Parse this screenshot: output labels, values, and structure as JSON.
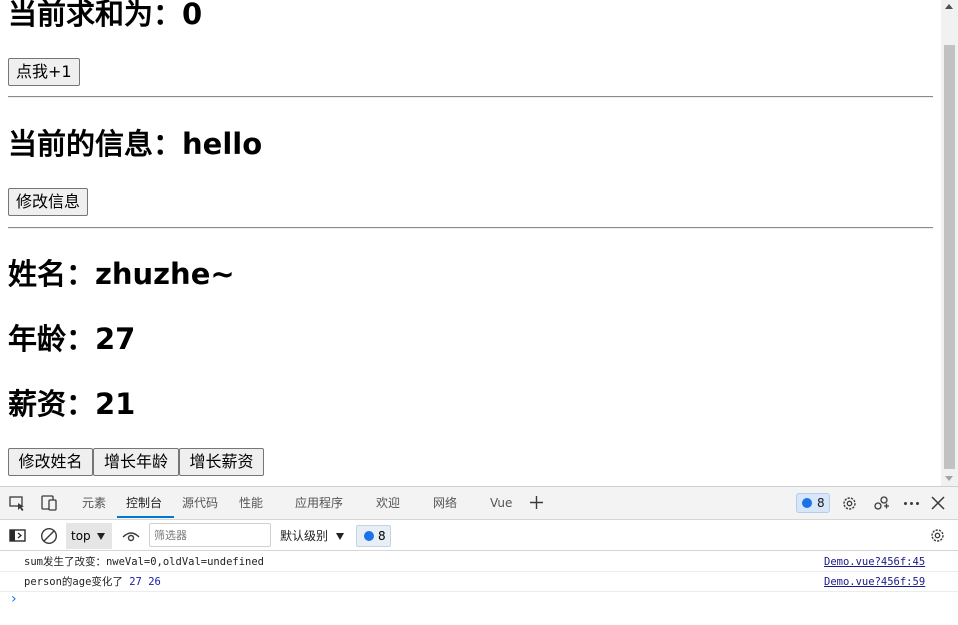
{
  "page": {
    "sum_text": "当前求和为：0",
    "add_button": "点我+1",
    "msg_text": "当前的信息：hello",
    "edit_msg_button": "修改信息",
    "name_text": "姓名：zhuzhe~",
    "age_text": "年龄：27",
    "salary_text": "薪资：21",
    "edit_name_button": "修改姓名",
    "grow_age_button": "增长年龄",
    "grow_salary_button": "增长薪资"
  },
  "devtools": {
    "tabs": [
      "元素",
      "控制台",
      "源代码",
      "性能",
      "应用程序",
      "欢迎",
      "网络",
      "Vue"
    ],
    "active_tab": "控制台",
    "message_count": "8",
    "context": "top",
    "filter_placeholder": "筛选器",
    "level": "默认级别",
    "level_count": "8",
    "accent_color": "#0078d4",
    "icons": [
      "inspect-element-icon",
      "device-emulation-icon",
      "add-tab-icon",
      "settings-gear-icon",
      "connect-icon",
      "more-options-icon",
      "close-icon",
      "sidebar-toggle-icon",
      "clear-console-icon",
      "live-expression-eye-icon",
      "console-settings-icon"
    ]
  },
  "console": {
    "logs": [
      {
        "msg": "sum发生了改变：nweVal=0,oldVal=undefined",
        "source": "Demo.vue?456f:45"
      },
      {
        "msg_prefix": "person的age变化了 ",
        "num1": "27",
        "num2": "26",
        "source": "Demo.vue?456f:59"
      }
    ],
    "prompt": "›"
  }
}
